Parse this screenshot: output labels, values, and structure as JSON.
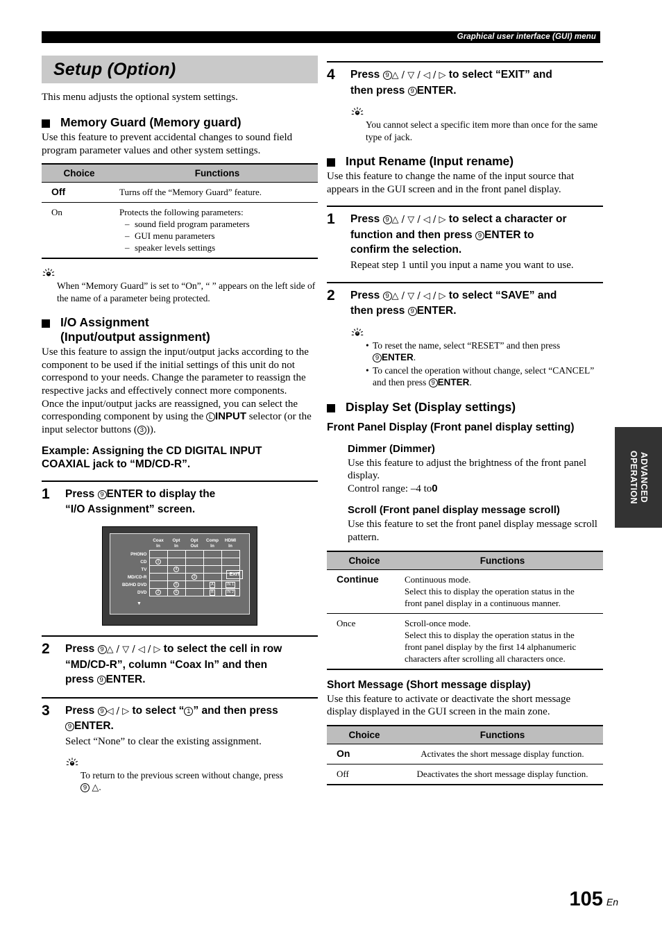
{
  "header": {
    "title": "Graphical user interface (GUI) menu"
  },
  "footer": {
    "page_number": "105",
    "language": "En"
  },
  "side_tab": {
    "line1": "ADVANCED",
    "line2": "OPERATION"
  },
  "left": {
    "page_title": "Setup (Option)",
    "intro": "This menu adjusts the optional system settings.",
    "memory_guard": {
      "heading": "Memory Guard (Memory guard)",
      "body": "Use this feature to prevent accidental changes to sound field program parameter values and other system settings.",
      "table": {
        "col_choice": "Choice",
        "col_functions": "Functions",
        "rows": [
          {
            "choice": "Off",
            "bold": true,
            "function": "Turns off the “Memory Guard” feature.",
            "items": []
          },
          {
            "choice": "On",
            "bold": false,
            "function": "Protects the following parameters:",
            "items": [
              "sound field program parameters",
              "GUI menu parameters",
              "speaker levels settings"
            ]
          }
        ]
      },
      "tip": "When “Memory Guard” is set to “On”, “ ” appears on the left side of the name of a parameter being protected."
    },
    "io_assignment": {
      "heading_line1": "I/O Assignment",
      "heading_line2": "(Input/output assignment)",
      "body1": "Use this feature to assign the input/output jacks according to the component to be used if the initial settings of this unit do not correspond to your needs. Change the parameter to reassign the respective jacks and effectively connect more components.",
      "body2_pre": "Once the input/output jacks are reassigned, you can select the corresponding component by using the ",
      "body2_input": "INPUT",
      "body2_post": " selector (or the input selector buttons (",
      "body2_end": ")).",
      "input_circle": "L",
      "buttons_circle": "3",
      "example_line1": "Example: Assigning the CD DIGITAL INPUT",
      "example_line2": "COAXIAL jack to “MD/CD-R”.",
      "steps": [
        {
          "num": "1",
          "text_line1_pre": "Press ",
          "text_line1_enter": "ENTER",
          "text_line1_post": " to display the",
          "text_line2": "“I/O Assignment” screen.",
          "circle": "9"
        },
        {
          "num": "2",
          "text_line1_pre": "Press ",
          "text_arrows": "△ / ▽ / ◁ / ▷",
          "text_line1_post": " to select the cell in row",
          "text_line2": "“MD/CD-R”, column “Coax In” and then",
          "text_line3_pre": "press ",
          "text_line3_enter": "ENTER.",
          "circle": "9"
        },
        {
          "num": "3",
          "text_line1_pre": "Press ",
          "text_arrows": "◁ / ▷",
          "text_line1_post": " to select “",
          "text_line1_end": "” and then press",
          "text_line2_enter": "ENTER.",
          "circle": "9",
          "circle_item": "1",
          "sub": "Select “None” to clear the existing assignment.",
          "tip_pre": "To return to the previous screen without change, press",
          "tip_post": "."
        }
      ],
      "gui_screen": {
        "columns": [
          "Coax In",
          "Opt In",
          "Opt Out",
          "Comp In",
          "HDMI In"
        ],
        "column_lines": [
          [
            "Coax",
            "In"
          ],
          [
            "Opt",
            "In"
          ],
          [
            "Opt",
            "Out"
          ],
          [
            "Comp",
            "In"
          ],
          [
            "HDMI",
            "In"
          ]
        ],
        "rows": [
          "PHONO",
          "CD",
          "TV",
          "MD/CD-R",
          "BD/HD DVD",
          "DVD"
        ],
        "cells": [
          [
            "",
            "",
            "",
            "",
            ""
          ],
          [
            "c1",
            "",
            "",
            "",
            ""
          ],
          [
            "",
            "c4",
            "",
            "",
            ""
          ],
          [
            "",
            "",
            "c3",
            "",
            ""
          ],
          [
            "",
            "c5",
            "",
            "bA",
            "bIN 1"
          ],
          [
            "c2",
            "c6",
            "",
            "bB",
            "bIN 2"
          ]
        ],
        "exit_label": "EXIT",
        "scroll_indicator": "▼"
      }
    }
  },
  "right": {
    "step4": {
      "num": "4",
      "text_line1_pre": "Press ",
      "text_arrows": "△ / ▽ / ◁ / ▷",
      "text_line1_post": " to select “EXIT” and",
      "text_line2_pre": "then press ",
      "text_line2_enter": "ENTER.",
      "circle": "9",
      "tip": "You cannot select a specific item more than once for the same type of jack."
    },
    "input_rename": {
      "heading": "Input Rename (Input rename)",
      "body": "Use this feature to change the name of the input source that appears in the GUI screen and in the front panel display.",
      "steps": [
        {
          "num": "1",
          "text_line1_pre": "Press ",
          "text_arrows": "△ / ▽ / ◁ / ▷",
          "text_line1_post": " to select a character or",
          "text_line2_pre": "function and then press ",
          "text_line2_enter": "ENTER",
          "text_line2_post": " to",
          "text_line3": "confirm the selection.",
          "circle": "9",
          "sub": "Repeat step 1 until you input a name you want to use."
        },
        {
          "num": "2",
          "text_line1_pre": "Press ",
          "text_arrows": "△ / ▽ / ◁ / ▷",
          "text_line1_post": " to select “SAVE” and",
          "text_line2_pre": "then press ",
          "text_line2_enter": "ENTER.",
          "circle": "9",
          "tips": [
            {
              "pre": "To reset the name, select “RESET” and then press",
              "enter": "ENTER",
              "post": "."
            },
            {
              "pre": "To cancel the operation without change, select “CANCEL” and then press ",
              "enter": "ENTER",
              "post": "."
            }
          ]
        }
      ]
    },
    "display_set": {
      "heading": "Display Set (Display settings)",
      "front_panel_display": "Front Panel Display (Front panel display setting)",
      "dimmer": {
        "heading": "Dimmer (Dimmer)",
        "body": "Use this feature to adjust the brightness of the front panel display.",
        "control_range_label": "Control range: ",
        "control_range_min": "–4",
        "control_range_mid": " to",
        "control_range_max": "0"
      },
      "scroll": {
        "heading": "Scroll (Front panel display message scroll)",
        "body": "Use this feature to set the front panel display message scroll pattern.",
        "table": {
          "col_choice": "Choice",
          "col_functions": "Functions",
          "rows": [
            {
              "choice": "Continue",
              "bold": true,
              "lines": [
                "Continuous mode.",
                "Select this to display the operation status in the",
                "front panel display in a continuous manner."
              ]
            },
            {
              "choice": "Once",
              "bold": false,
              "lines": [
                "Scroll-once mode.",
                "Select this to display the operation status in the",
                "front panel display by the first 14 alphanumeric",
                "characters after scrolling all characters once."
              ]
            }
          ]
        }
      },
      "short_message": {
        "heading": "Short Message (Short message display)",
        "body": "Use this feature to activate or deactivate the short message display displayed in the GUI screen in the main zone.",
        "table": {
          "col_choice": "Choice",
          "col_functions": "Functions",
          "rows": [
            {
              "choice": "On",
              "bold": true,
              "function": "Activates the short message display function."
            },
            {
              "choice": "Off",
              "bold": false,
              "function": "Deactivates the short message display function."
            }
          ]
        }
      }
    }
  }
}
